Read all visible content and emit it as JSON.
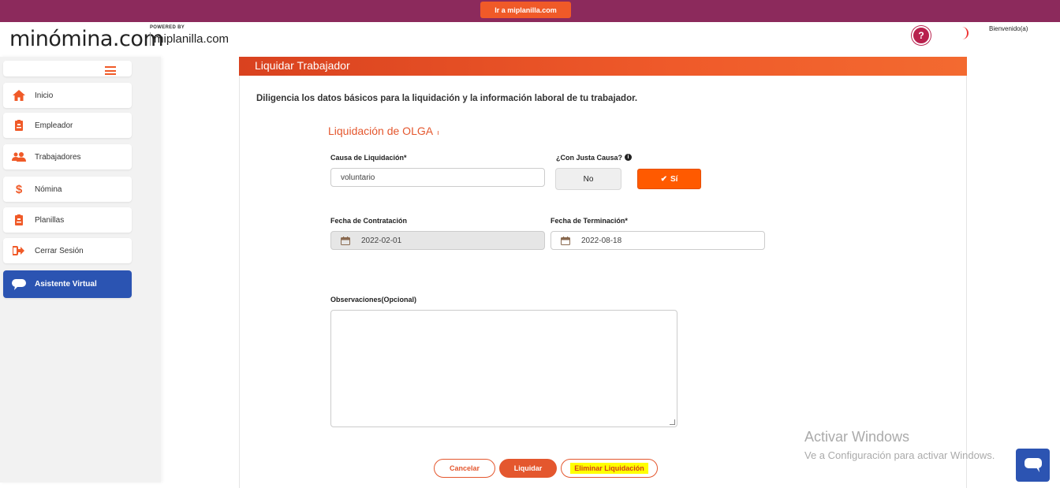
{
  "topbar": {
    "button_label": "Ir a miplanilla.com"
  },
  "header": {
    "logo_text": "minómina.com",
    "powered_by": "POWERED BY",
    "partner": "miplanilla.com",
    "help_glyph": "?",
    "welcome": "Bienvenido(a)"
  },
  "sidebar": {
    "items": [
      {
        "label": "Inicio",
        "icon": "home-icon"
      },
      {
        "label": "Empleador",
        "icon": "badge-icon"
      },
      {
        "label": "Trabajadores",
        "icon": "users-icon"
      },
      {
        "label": "Nómina",
        "icon": "dollar-icon"
      },
      {
        "label": "Planillas",
        "icon": "badge-icon"
      },
      {
        "label": "Cerrar Sesión",
        "icon": "sign-out-icon"
      },
      {
        "label": "Asistente Virtual",
        "icon": "chat-icon"
      }
    ]
  },
  "main": {
    "title": "Liquidar Trabajador",
    "intro": "Diligencia los datos básicos para la liquidación y la información laboral de tu trabajador.",
    "subtitle": "Liquidación de OLGA"
  },
  "form": {
    "causa_label": "Causa de Liquidación*",
    "causa_value": "voluntario",
    "justa_label": "¿Con Justa Causa?",
    "no_label": "No",
    "si_label": "Sí",
    "contratacion_label": "Fecha de Contratación",
    "contratacion_value": "2022-02-01",
    "terminacion_label": "Fecha de Terminación*",
    "terminacion_value": "2022-08-18",
    "observaciones_label": "Observaciones(Opcional)"
  },
  "actions": {
    "cancel_label": "Cancelar",
    "liquidar_label": "Liquidar",
    "eliminar_label": "Eliminar Liquidación"
  },
  "watermark": {
    "line1": "Activar Windows",
    "line2": "Ve a Configuración para activar Windows."
  },
  "colors": {
    "accent": "#e4572e",
    "topbar": "#8c2a5c",
    "active": "#2b54b2"
  }
}
